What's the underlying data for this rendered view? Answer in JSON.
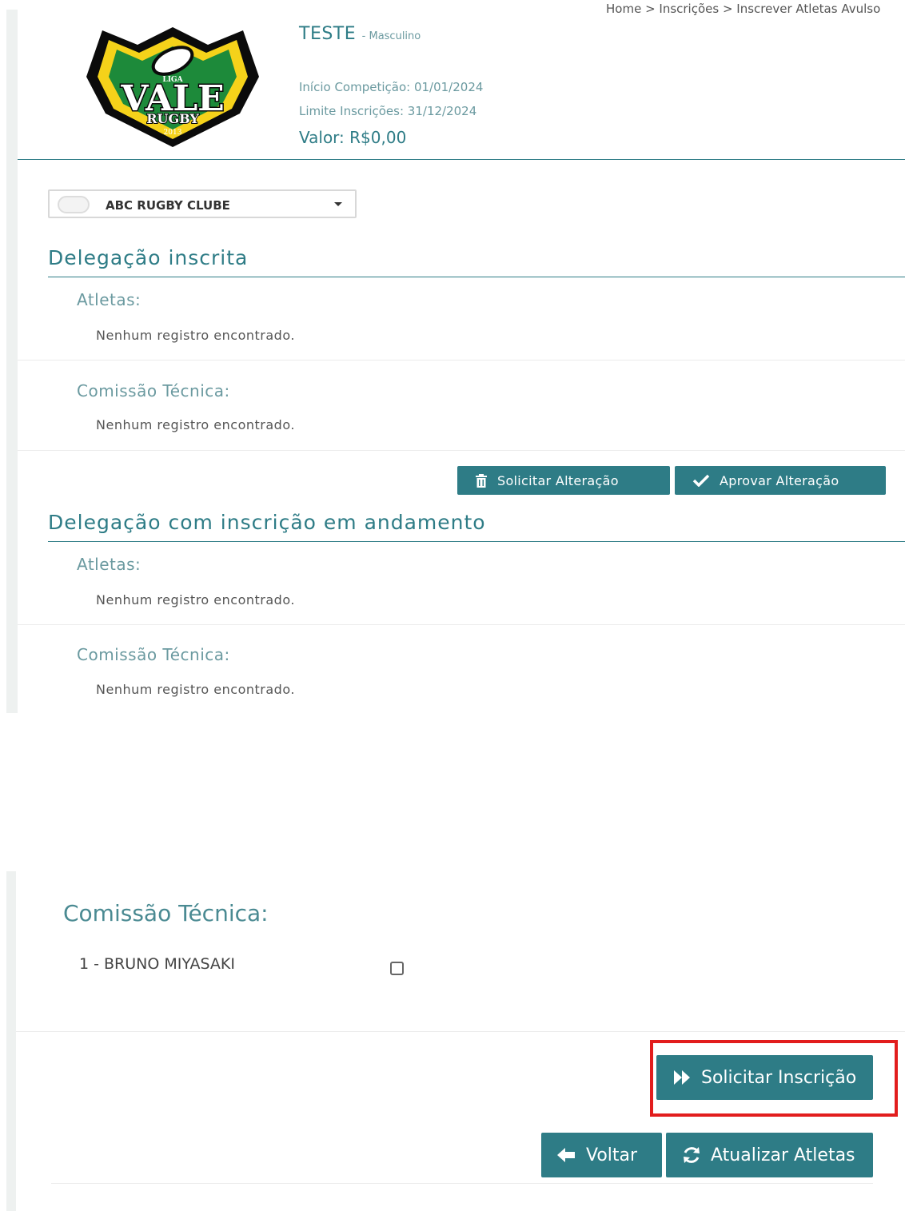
{
  "breadcrumb": "Home  >  Inscrições  >  Inscrever Atletas Avulso",
  "competition": {
    "name": "TESTE",
    "category": "- Masculino",
    "start": "Início Competição: 01/01/2024",
    "deadline": "Limite Inscrições: 31/12/2024",
    "value": "Valor: R$0,00"
  },
  "logo": {
    "top": "LIGA",
    "main": "VALE",
    "sub": "RUGBY",
    "year": "2013"
  },
  "club_select": {
    "selected": "ABC RUGBY CLUBE"
  },
  "registered": {
    "title": "Delegação inscrita",
    "athletes_label": "Atletas:",
    "athletes_empty": "Nenhum registro encontrado.",
    "staff_label": "Comissão Técnica:",
    "staff_empty": "Nenhum registro encontrado."
  },
  "actions": {
    "request_change": "Solicitar Alteração",
    "approve_change": "Aprovar Alteração"
  },
  "pending": {
    "title": "Delegação com inscrição em andamento",
    "athletes_label": "Atletas:",
    "athletes_empty": "Nenhum registro encontrado.",
    "staff_label": "Comissão Técnica:",
    "staff_empty": "Nenhum registro encontrado."
  },
  "selection": {
    "staff_label": "Comissão Técnica:",
    "members": [
      {
        "text": "1 - BRUNO MIYASAKI",
        "checked": false
      }
    ]
  },
  "footer": {
    "request_registration": "Solicitar Inscrição",
    "back": "Voltar",
    "refresh_athletes": "Atualizar Atletas"
  },
  "colors": {
    "teal": "#2e7c86",
    "highlight": "#e21d1d"
  }
}
